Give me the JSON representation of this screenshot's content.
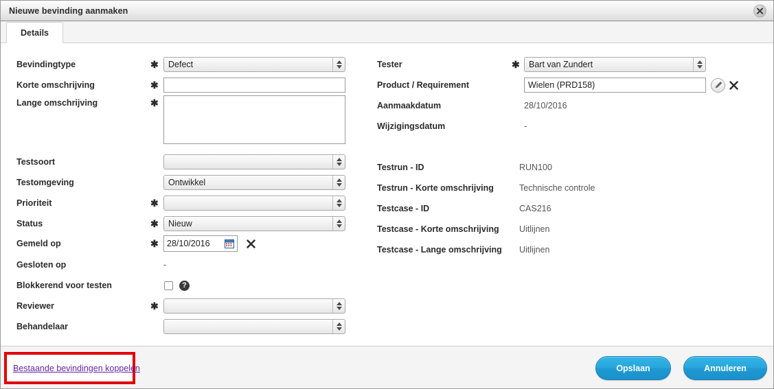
{
  "window": {
    "title": "Nieuwe bevinding aanmaken",
    "close_icon": "close-icon"
  },
  "tabs": [
    {
      "label": "Details",
      "active": true
    }
  ],
  "left_column": {
    "fields": [
      {
        "label": "Bevindingtype",
        "required": true,
        "type": "select",
        "value": "Defect"
      },
      {
        "label": "Korte omschrijving",
        "required": true,
        "type": "text",
        "value": ""
      },
      {
        "label": "Lange omschrijving",
        "required": true,
        "type": "textarea",
        "value": ""
      },
      {
        "label": "Testsoort",
        "required": false,
        "type": "select",
        "value": ""
      },
      {
        "label": "Testomgeving",
        "required": false,
        "type": "select",
        "value": "Ontwikkel"
      },
      {
        "label": "Prioriteit",
        "required": true,
        "type": "select",
        "value": ""
      },
      {
        "label": "Status",
        "required": true,
        "type": "select",
        "value": "Nieuw"
      },
      {
        "label": "Gemeld op",
        "required": true,
        "type": "date",
        "value": "28/10/2016"
      },
      {
        "label": "Gesloten op",
        "required": false,
        "type": "static",
        "value": "-"
      },
      {
        "label": "Blokkerend voor testen",
        "required": false,
        "type": "checkbox",
        "value": ""
      },
      {
        "label": "Reviewer",
        "required": true,
        "type": "select",
        "value": ""
      },
      {
        "label": "Behandelaar",
        "required": false,
        "type": "select",
        "value": ""
      }
    ],
    "icons": {
      "calendar": "calendar-icon",
      "clear_date": "clear-date-icon",
      "help": "help-icon",
      "help_glyph": "?"
    }
  },
  "right_column": {
    "fields": [
      {
        "label": "Tester",
        "required": true,
        "type": "select",
        "value": "Bart van Zundert"
      },
      {
        "label": "Product / Requirement",
        "required": false,
        "type": "text",
        "value": "Wielen (PRD158)"
      },
      {
        "label": "Aanmaakdatum",
        "required": false,
        "type": "static",
        "value": "28/10/2016"
      },
      {
        "label": "Wijzigingsdatum",
        "required": false,
        "type": "static",
        "value": "-"
      },
      {
        "label": "Testrun - ID",
        "required": false,
        "type": "static",
        "value": "RUN100"
      },
      {
        "label": "Testrun - Korte omschrijving",
        "required": false,
        "type": "static",
        "value": "Technische controle"
      },
      {
        "label": "Testcase - ID",
        "required": false,
        "type": "static",
        "value": "CAS216"
      },
      {
        "label": "Testcase - Korte omschrijving",
        "required": false,
        "type": "static",
        "value": "Uitlijnen"
      },
      {
        "label": "Testcase - Lange omschrijving",
        "required": false,
        "type": "static",
        "value": "Uitlijnen"
      }
    ],
    "icons": {
      "edit": "edit-pencil-icon",
      "clear": "clear-icon"
    }
  },
  "footer": {
    "link_label": "Bestaande bevindingen koppelen",
    "save_label": "Opslaan",
    "cancel_label": "Annuleren",
    "highlight_color": "#e00000",
    "link_color": "#6b24a8",
    "button_color": "#27a6dd"
  }
}
